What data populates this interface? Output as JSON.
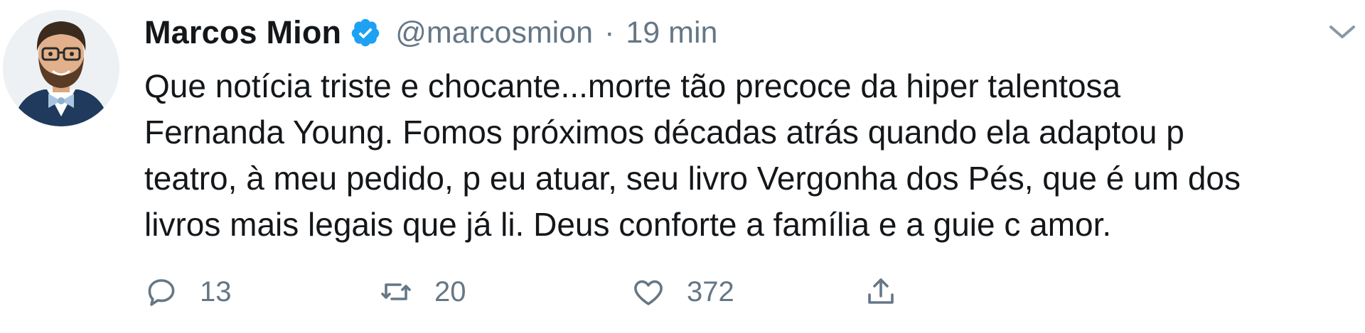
{
  "tweet": {
    "author": {
      "name": "Marcos Mion",
      "handle": "@marcosmion",
      "verified": true
    },
    "separator": "·",
    "timestamp": "19 min",
    "text": "Que notícia triste e chocante...morte tão precoce da hiper talentosa\nFernanda Young. Fomos próximos décadas atrás quando ela adaptou p\nteatro, à meu pedido, p eu atuar, seu livro Vergonha dos Pés, que é um dos\nlivros mais legais que já li. Deus conforte a família e a guie c amor.",
    "actions": {
      "reply": {
        "icon": "reply-icon",
        "count": "13"
      },
      "retweet": {
        "icon": "retweet-icon",
        "count": "20"
      },
      "like": {
        "icon": "heart-icon",
        "count": "372"
      },
      "share": {
        "icon": "share-icon"
      }
    },
    "menu_icon": "chevron-down-icon"
  },
  "colors": {
    "text": "#14171a",
    "secondary": "#657786",
    "verified_blue": "#1da1f2",
    "background": "#ffffff"
  }
}
